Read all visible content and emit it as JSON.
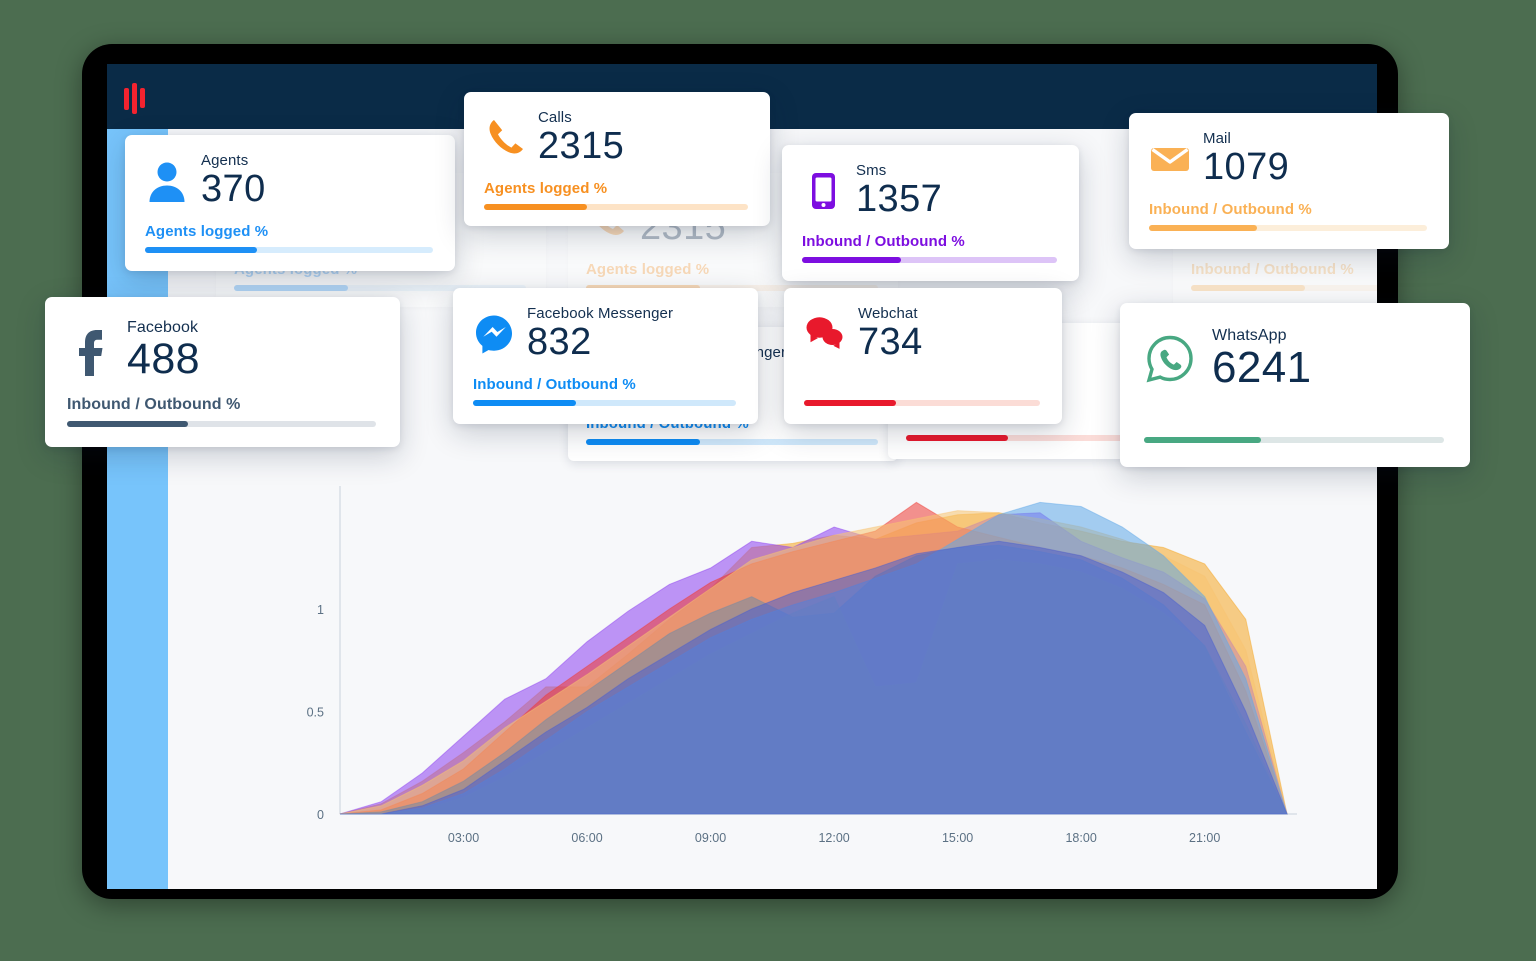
{
  "app": {
    "logo_name": "waveform-logo",
    "topbar_color": "#0a2b47",
    "sidebar_color": "#77c4fb",
    "page_background": "#4c6d50",
    "screen_background": "#f7f8fa"
  },
  "cards": {
    "agents": {
      "label": "Agents",
      "value": "370",
      "bar_label": "Agents logged %",
      "bar_percent": 39,
      "color": "#1e90f5",
      "icon": "user-icon"
    },
    "calls": {
      "label": "Calls",
      "value": "2315",
      "bar_label": "Agents logged %",
      "bar_percent": 39,
      "color": "#f79021",
      "icon": "phone-icon"
    },
    "sms": {
      "label": "Sms",
      "value": "1357",
      "bar_label": "Inbound / Outbound %",
      "bar_percent": 39,
      "color": "#7d0ee0",
      "icon": "mobile-phone-icon"
    },
    "mail": {
      "label": "Mail",
      "value": "1079",
      "bar_label": "Inbound / Outbound %",
      "bar_percent": 39,
      "color": "#fbb košice",
      "bar_color": "#fab155",
      "icon": "envelope-icon"
    },
    "facebook": {
      "label": "Facebook",
      "value": "488",
      "bar_label": "Inbound / Outbound %",
      "bar_percent": 39,
      "color": "#3f5871",
      "icon": "facebook-icon"
    },
    "messenger": {
      "label": "Facebook Messenger",
      "value": "832",
      "bar_label": "Inbound / Outbound %",
      "bar_percent": 39,
      "color": "#0e8cf4",
      "icon": "messenger-icon"
    },
    "webchat": {
      "label": "Webchat",
      "value": "734",
      "bar_label": "",
      "bar_percent": 39,
      "color": "#e8192c",
      "icon": "chat-bubbles-icon"
    },
    "whatsapp": {
      "label": "WhatsApp",
      "value": "6241",
      "bar_label": "",
      "bar_percent": 39,
      "color": "#48a882",
      "icon": "whatsapp-icon"
    }
  },
  "chart_data": {
    "type": "area",
    "title": "",
    "xlabel": "",
    "ylabel": "",
    "grid": false,
    "legend": "none",
    "ylim": [
      0,
      1.6
    ],
    "yticks": [
      0,
      0.5,
      1
    ],
    "ytick_labels": [
      "0",
      "0.5",
      "1"
    ],
    "xticks": [
      "03:00",
      "06:00",
      "09:00",
      "12:00",
      "15:00",
      "18:00",
      "21:00"
    ],
    "x": [
      "00:00",
      "01:00",
      "02:00",
      "03:00",
      "04:00",
      "05:00",
      "06:00",
      "07:00",
      "08:00",
      "09:00",
      "10:00",
      "11:00",
      "12:00",
      "13:00",
      "14:00",
      "15:00",
      "16:00",
      "17:00",
      "18:00",
      "19:00",
      "20:00",
      "21:00",
      "22:00",
      "23:00"
    ],
    "series": [
      {
        "name": "Calls",
        "color": "#f5a623",
        "values": [
          0,
          0.05,
          0.16,
          0.3,
          0.45,
          0.62,
          0.62,
          0.78,
          0.95,
          1.1,
          1.3,
          1.32,
          1.36,
          1.34,
          1.42,
          1.46,
          1.47,
          1.42,
          1.38,
          1.33,
          1.3,
          1.22,
          0.95,
          0
        ]
      },
      {
        "name": "Sms",
        "color": "#8c3ff0",
        "values": [
          0,
          0.06,
          0.2,
          0.38,
          0.56,
          0.66,
          0.84,
          0.99,
          1.12,
          1.2,
          1.33,
          1.3,
          1.4,
          1.34,
          1.36,
          1.38,
          1.46,
          1.47,
          1.33,
          1.25,
          1.18,
          1.05,
          0.72,
          0
        ]
      },
      {
        "name": "Webchat",
        "color": "#ef3b33",
        "values": [
          0,
          0.02,
          0.1,
          0.22,
          0.4,
          0.58,
          0.72,
          0.86,
          1.0,
          1.13,
          1.22,
          1.28,
          1.33,
          1.38,
          1.52,
          1.4,
          1.35,
          1.3,
          1.26,
          1.2,
          1.12,
          1.02,
          0.6,
          0
        ]
      },
      {
        "name": "Mail",
        "color": "#f8c471",
        "values": [
          0,
          0.04,
          0.14,
          0.26,
          0.42,
          0.55,
          0.68,
          0.82,
          0.96,
          1.1,
          1.24,
          1.3,
          1.36,
          1.4,
          1.44,
          1.48,
          1.47,
          1.44,
          1.4,
          1.34,
          1.26,
          1.16,
          0.8,
          0
        ]
      },
      {
        "name": "Facebook",
        "color": "#6f8aa6",
        "values": [
          0,
          0.01,
          0.06,
          0.16,
          0.3,
          0.46,
          0.6,
          0.74,
          0.88,
          0.98,
          1.06,
          0.96,
          0.98,
          1.16,
          1.26,
          1.3,
          1.31,
          1.28,
          1.24,
          1.15,
          1.02,
          0.82,
          0.4,
          0
        ]
      },
      {
        "name": "Messenger",
        "color": "#5fa8e8",
        "values": [
          0,
          0.0,
          0.03,
          0.1,
          0.22,
          0.36,
          0.5,
          0.62,
          0.74,
          0.86,
          0.95,
          1.02,
          1.08,
          1.15,
          1.22,
          1.34,
          1.46,
          1.52,
          1.5,
          1.4,
          1.26,
          1.06,
          0.66,
          0
        ]
      },
      {
        "name": "WhatsApp",
        "color": "#7fa6b5",
        "values": [
          0,
          0.0,
          0.02,
          0.08,
          0.18,
          0.3,
          0.42,
          0.54,
          0.66,
          0.78,
          0.88,
          0.98,
          1.06,
          0.62,
          0.64,
          1.22,
          1.24,
          1.22,
          1.18,
          1.1,
          0.98,
          0.82,
          0.44,
          0
        ]
      },
      {
        "name": "Agents",
        "color": "#4a5fd0",
        "values": [
          0,
          0.0,
          0.04,
          0.12,
          0.26,
          0.4,
          0.52,
          0.66,
          0.78,
          0.9,
          1.0,
          1.08,
          1.14,
          1.2,
          1.27,
          1.3,
          1.33,
          1.3,
          1.26,
          1.18,
          1.08,
          0.92,
          0.5,
          0
        ]
      }
    ]
  }
}
